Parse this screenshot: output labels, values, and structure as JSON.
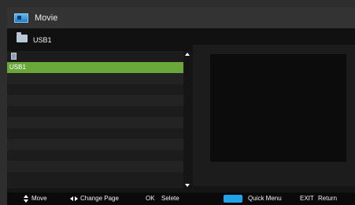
{
  "window": {
    "title": "Movie",
    "icon": "movie-app-icon"
  },
  "path": {
    "label": "USB1",
    "icon": "folder-icon"
  },
  "list": {
    "items": [
      {
        "label": "",
        "icon": "drive-icon",
        "selected": false
      },
      {
        "label": "USB1",
        "icon": "",
        "selected": true
      }
    ]
  },
  "footer": {
    "move_icon": "updown-arrows-icon",
    "move": "Move",
    "change_page_icon": "leftright-arrows-icon",
    "change_page": "Change Page",
    "ok_key": "OK",
    "ok_action": "Selete",
    "quick_menu_key_color": "#1fa3ea",
    "quick_menu": "Quick Menu",
    "exit_key": "EXIT",
    "exit_action": "Return"
  },
  "colors": {
    "selection": "#6aa83a",
    "titlebar": "#333333",
    "background": "#151515"
  }
}
